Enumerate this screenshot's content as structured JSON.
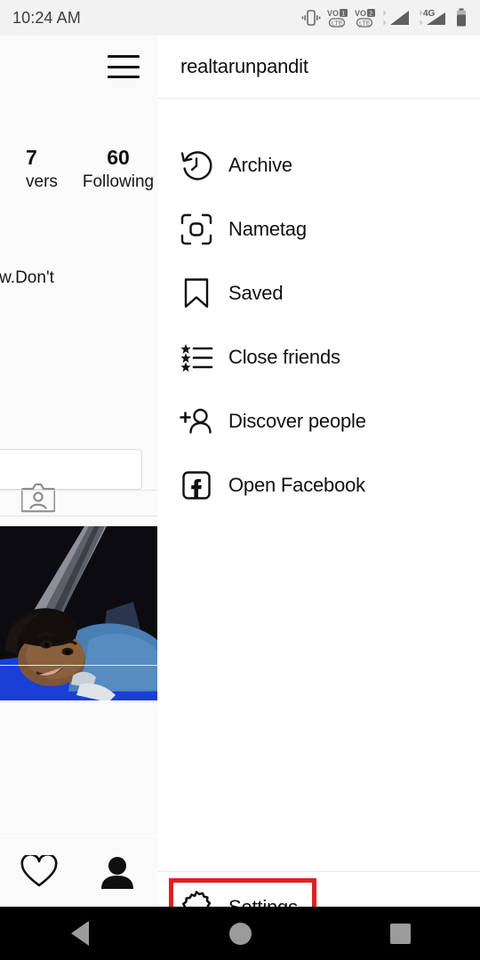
{
  "status_bar": {
    "time": "10:24 AM",
    "icons": [
      "vibrate-icon",
      "volte-sim1-icon",
      "volte-sim2-icon",
      "signal-sim1-icon",
      "network-4g-icon",
      "signal-sim2-icon",
      "battery-icon"
    ],
    "network_label": "4G",
    "volte_label": "VO",
    "lte_label": "LTE"
  },
  "profile_panel": {
    "menu_button": "hamburger-menu",
    "stats": [
      {
        "value": "7",
        "label": "vers"
      },
      {
        "value": "60",
        "label": "Following"
      }
    ],
    "bio": "how.Don't",
    "edit_profile_button": "",
    "tagged_icon": "tagged-photos-icon",
    "tabs": [
      {
        "name": "activity-tab",
        "icon": "heart-icon",
        "active": false
      },
      {
        "name": "profile-tab",
        "icon": "person-icon",
        "active": true
      }
    ]
  },
  "menu_panel": {
    "username": "realtarunpandit",
    "items": [
      {
        "label": "Archive",
        "icon": "archive-clock-icon"
      },
      {
        "label": "Nametag",
        "icon": "nametag-scan-icon"
      },
      {
        "label": "Saved",
        "icon": "bookmark-icon"
      },
      {
        "label": "Close friends",
        "icon": "close-friends-star-list-icon"
      },
      {
        "label": "Discover people",
        "icon": "add-person-icon"
      },
      {
        "label": "Open Facebook",
        "icon": "facebook-icon"
      }
    ],
    "settings": {
      "label": "Settings",
      "icon": "gear-icon",
      "highlighted": true,
      "highlight_color": "#e02020"
    }
  },
  "nav_bar": {
    "buttons": [
      {
        "name": "back-button",
        "icon": "triangle-back-icon"
      },
      {
        "name": "home-button",
        "icon": "circle-home-icon"
      },
      {
        "name": "recents-button",
        "icon": "square-recents-icon"
      }
    ]
  },
  "colors": {
    "accent_red": "#e02020",
    "status_bar_bg": "#f2f2f2",
    "panel_bg": "#fafafa",
    "menu_bg": "#ffffff"
  }
}
